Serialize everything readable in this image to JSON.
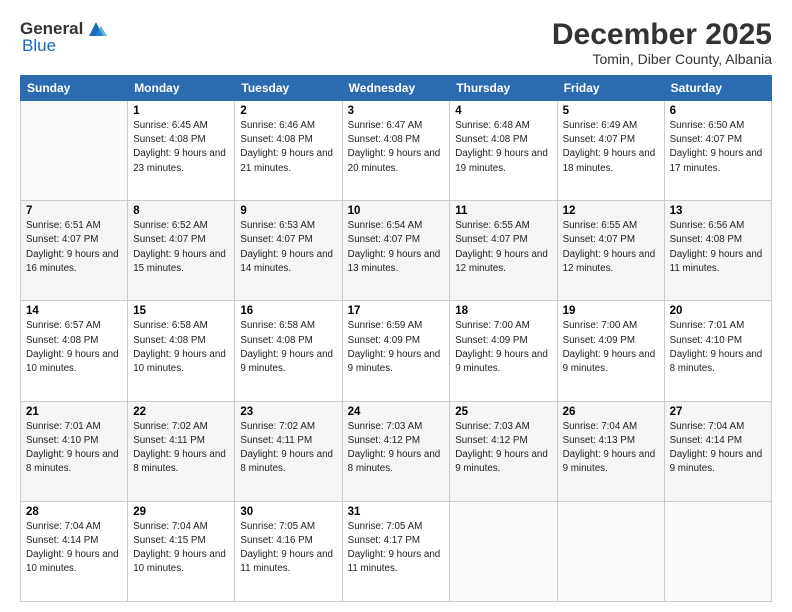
{
  "logo": {
    "general": "General",
    "blue": "Blue"
  },
  "title": "December 2025",
  "location": "Tomin, Diber County, Albania",
  "days_header": [
    "Sunday",
    "Monday",
    "Tuesday",
    "Wednesday",
    "Thursday",
    "Friday",
    "Saturday"
  ],
  "weeks": [
    [
      {
        "day": "",
        "sunrise": "",
        "sunset": "",
        "daylight": ""
      },
      {
        "day": "1",
        "sunrise": "Sunrise: 6:45 AM",
        "sunset": "Sunset: 4:08 PM",
        "daylight": "Daylight: 9 hours and 23 minutes."
      },
      {
        "day": "2",
        "sunrise": "Sunrise: 6:46 AM",
        "sunset": "Sunset: 4:08 PM",
        "daylight": "Daylight: 9 hours and 21 minutes."
      },
      {
        "day": "3",
        "sunrise": "Sunrise: 6:47 AM",
        "sunset": "Sunset: 4:08 PM",
        "daylight": "Daylight: 9 hours and 20 minutes."
      },
      {
        "day": "4",
        "sunrise": "Sunrise: 6:48 AM",
        "sunset": "Sunset: 4:08 PM",
        "daylight": "Daylight: 9 hours and 19 minutes."
      },
      {
        "day": "5",
        "sunrise": "Sunrise: 6:49 AM",
        "sunset": "Sunset: 4:07 PM",
        "daylight": "Daylight: 9 hours and 18 minutes."
      },
      {
        "day": "6",
        "sunrise": "Sunrise: 6:50 AM",
        "sunset": "Sunset: 4:07 PM",
        "daylight": "Daylight: 9 hours and 17 minutes."
      }
    ],
    [
      {
        "day": "7",
        "sunrise": "Sunrise: 6:51 AM",
        "sunset": "Sunset: 4:07 PM",
        "daylight": "Daylight: 9 hours and 16 minutes."
      },
      {
        "day": "8",
        "sunrise": "Sunrise: 6:52 AM",
        "sunset": "Sunset: 4:07 PM",
        "daylight": "Daylight: 9 hours and 15 minutes."
      },
      {
        "day": "9",
        "sunrise": "Sunrise: 6:53 AM",
        "sunset": "Sunset: 4:07 PM",
        "daylight": "Daylight: 9 hours and 14 minutes."
      },
      {
        "day": "10",
        "sunrise": "Sunrise: 6:54 AM",
        "sunset": "Sunset: 4:07 PM",
        "daylight": "Daylight: 9 hours and 13 minutes."
      },
      {
        "day": "11",
        "sunrise": "Sunrise: 6:55 AM",
        "sunset": "Sunset: 4:07 PM",
        "daylight": "Daylight: 9 hours and 12 minutes."
      },
      {
        "day": "12",
        "sunrise": "Sunrise: 6:55 AM",
        "sunset": "Sunset: 4:07 PM",
        "daylight": "Daylight: 9 hours and 12 minutes."
      },
      {
        "day": "13",
        "sunrise": "Sunrise: 6:56 AM",
        "sunset": "Sunset: 4:08 PM",
        "daylight": "Daylight: 9 hours and 11 minutes."
      }
    ],
    [
      {
        "day": "14",
        "sunrise": "Sunrise: 6:57 AM",
        "sunset": "Sunset: 4:08 PM",
        "daylight": "Daylight: 9 hours and 10 minutes."
      },
      {
        "day": "15",
        "sunrise": "Sunrise: 6:58 AM",
        "sunset": "Sunset: 4:08 PM",
        "daylight": "Daylight: 9 hours and 10 minutes."
      },
      {
        "day": "16",
        "sunrise": "Sunrise: 6:58 AM",
        "sunset": "Sunset: 4:08 PM",
        "daylight": "Daylight: 9 hours and 9 minutes."
      },
      {
        "day": "17",
        "sunrise": "Sunrise: 6:59 AM",
        "sunset": "Sunset: 4:09 PM",
        "daylight": "Daylight: 9 hours and 9 minutes."
      },
      {
        "day": "18",
        "sunrise": "Sunrise: 7:00 AM",
        "sunset": "Sunset: 4:09 PM",
        "daylight": "Daylight: 9 hours and 9 minutes."
      },
      {
        "day": "19",
        "sunrise": "Sunrise: 7:00 AM",
        "sunset": "Sunset: 4:09 PM",
        "daylight": "Daylight: 9 hours and 9 minutes."
      },
      {
        "day": "20",
        "sunrise": "Sunrise: 7:01 AM",
        "sunset": "Sunset: 4:10 PM",
        "daylight": "Daylight: 9 hours and 8 minutes."
      }
    ],
    [
      {
        "day": "21",
        "sunrise": "Sunrise: 7:01 AM",
        "sunset": "Sunset: 4:10 PM",
        "daylight": "Daylight: 9 hours and 8 minutes."
      },
      {
        "day": "22",
        "sunrise": "Sunrise: 7:02 AM",
        "sunset": "Sunset: 4:11 PM",
        "daylight": "Daylight: 9 hours and 8 minutes."
      },
      {
        "day": "23",
        "sunrise": "Sunrise: 7:02 AM",
        "sunset": "Sunset: 4:11 PM",
        "daylight": "Daylight: 9 hours and 8 minutes."
      },
      {
        "day": "24",
        "sunrise": "Sunrise: 7:03 AM",
        "sunset": "Sunset: 4:12 PM",
        "daylight": "Daylight: 9 hours and 8 minutes."
      },
      {
        "day": "25",
        "sunrise": "Sunrise: 7:03 AM",
        "sunset": "Sunset: 4:12 PM",
        "daylight": "Daylight: 9 hours and 9 minutes."
      },
      {
        "day": "26",
        "sunrise": "Sunrise: 7:04 AM",
        "sunset": "Sunset: 4:13 PM",
        "daylight": "Daylight: 9 hours and 9 minutes."
      },
      {
        "day": "27",
        "sunrise": "Sunrise: 7:04 AM",
        "sunset": "Sunset: 4:14 PM",
        "daylight": "Daylight: 9 hours and 9 minutes."
      }
    ],
    [
      {
        "day": "28",
        "sunrise": "Sunrise: 7:04 AM",
        "sunset": "Sunset: 4:14 PM",
        "daylight": "Daylight: 9 hours and 10 minutes."
      },
      {
        "day": "29",
        "sunrise": "Sunrise: 7:04 AM",
        "sunset": "Sunset: 4:15 PM",
        "daylight": "Daylight: 9 hours and 10 minutes."
      },
      {
        "day": "30",
        "sunrise": "Sunrise: 7:05 AM",
        "sunset": "Sunset: 4:16 PM",
        "daylight": "Daylight: 9 hours and 11 minutes."
      },
      {
        "day": "31",
        "sunrise": "Sunrise: 7:05 AM",
        "sunset": "Sunset: 4:17 PM",
        "daylight": "Daylight: 9 hours and 11 minutes."
      },
      {
        "day": "",
        "sunrise": "",
        "sunset": "",
        "daylight": ""
      },
      {
        "day": "",
        "sunrise": "",
        "sunset": "",
        "daylight": ""
      },
      {
        "day": "",
        "sunrise": "",
        "sunset": "",
        "daylight": ""
      }
    ]
  ]
}
